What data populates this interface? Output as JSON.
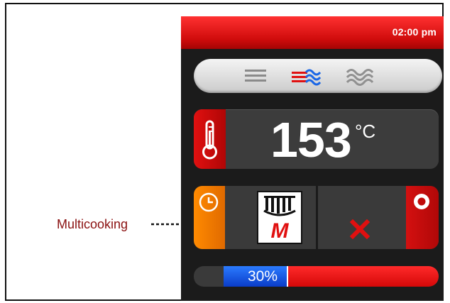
{
  "annotation": {
    "label": "Multicooking"
  },
  "status": {
    "time": "02:00 pm"
  },
  "modes": {
    "items": [
      {
        "name": "convection",
        "icon": "three-lines-icon",
        "selected": false
      },
      {
        "name": "combi",
        "icon": "lines-waves-icon",
        "selected": true
      },
      {
        "name": "steam",
        "icon": "waves-icon",
        "selected": false
      }
    ]
  },
  "temperature": {
    "value": "153",
    "unit": "°C",
    "icon": "thermometer-icon"
  },
  "program": {
    "timer_icon": "clock-icon",
    "multicook_icon": "multicooking-icon",
    "multicook_letter": "M",
    "cancel_icon": "cancel-x-icon",
    "record_icon": "target-icon"
  },
  "progress": {
    "percent_label": "30%",
    "fraction": 0.3
  },
  "colors": {
    "accent_red": "#e01010",
    "timer_orange": "#ff8a00",
    "progress_blue": "#1b55e6",
    "annotation": "#8a1010"
  }
}
